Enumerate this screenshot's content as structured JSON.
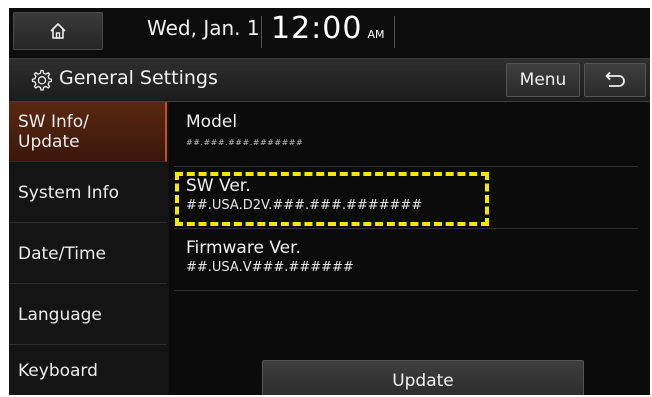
{
  "status": {
    "home_icon": "home-icon",
    "date": "Wed, Jan. 1",
    "time": "12:00",
    "ampm": "AM"
  },
  "titlebar": {
    "gear_icon": "gear-icon",
    "title": "General Settings",
    "menu_label": "Menu",
    "back_icon": "back-arrow-icon"
  },
  "sidebar": {
    "items": [
      {
        "label": "SW Info/\nUpdate",
        "active": true
      },
      {
        "label": "System Info",
        "active": false
      },
      {
        "label": "Date/Time",
        "active": false
      },
      {
        "label": "Language",
        "active": false
      },
      {
        "label": "Keyboard",
        "active": false
      }
    ]
  },
  "content": {
    "model": {
      "label": "Model",
      "value": "##.###.###.#######"
    },
    "sw_version": {
      "label": "SW Ver.",
      "value": "##.USA.D2V.###.###.#######"
    },
    "firmware_version": {
      "label": "Firmware Ver.",
      "value": "##.USA.V###.######"
    },
    "update_label": "Update"
  },
  "colors": {
    "highlight": "#f5e800",
    "active_tab": "#5a2812",
    "background": "#0b0b0b"
  }
}
